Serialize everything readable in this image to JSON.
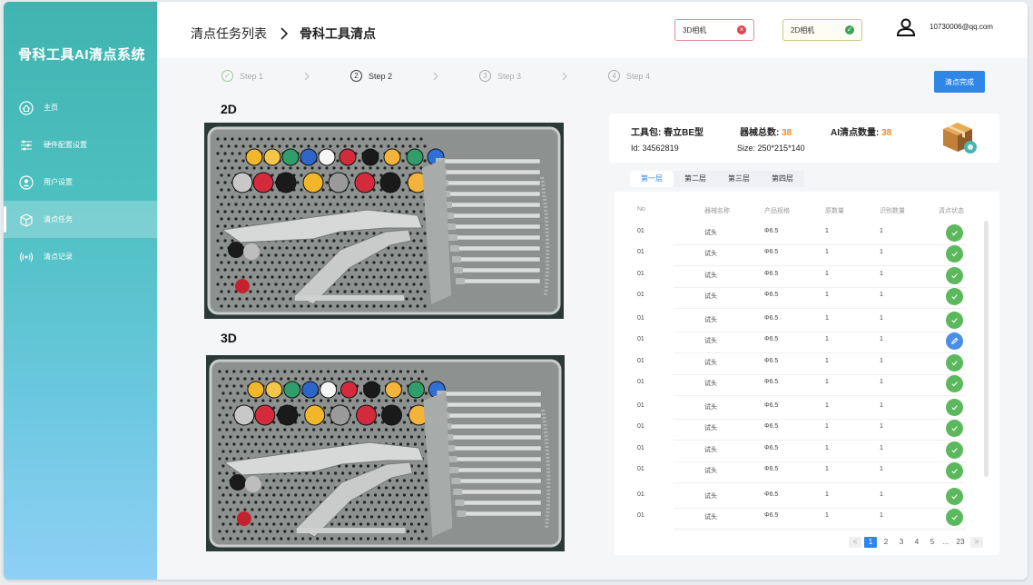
{
  "app": {
    "title": "骨科工具AI清点系统"
  },
  "sidebar": {
    "items": [
      {
        "label": "主页",
        "icon": "home-icon",
        "active": false
      },
      {
        "label": "硬件配置设置",
        "icon": "sliders-icon",
        "active": false
      },
      {
        "label": "用户设置",
        "icon": "user-icon",
        "active": false
      },
      {
        "label": "清点任务",
        "icon": "box-icon",
        "active": true
      },
      {
        "label": "清点记录",
        "icon": "signal-icon",
        "active": false
      }
    ]
  },
  "header": {
    "breadcrumb_parent": "清点任务列表",
    "breadcrumb_current": "骨科工具清点",
    "camera_3d": {
      "label": "3D相机",
      "status": "error"
    },
    "camera_2d": {
      "label": "2D相机",
      "status": "ok"
    },
    "user_email": "10730006@qq.com"
  },
  "steps": [
    {
      "label": "Step 1",
      "marker": "✓",
      "state": "done"
    },
    {
      "label": "Step 2",
      "marker": "2",
      "state": "current"
    },
    {
      "label": "Step 3",
      "marker": "3",
      "state": "todo"
    },
    {
      "label": "Step 4",
      "marker": "4",
      "state": "todo"
    }
  ],
  "finish_button": "清点完成",
  "images": {
    "label_2d": "2D",
    "label_3d": "3D"
  },
  "toolkit": {
    "kit_label": "工具包:",
    "kit_name": "春立BE型",
    "total_label": "器械总数:",
    "total_value": "38",
    "ai_label": "AI清点数量:",
    "ai_value": "38",
    "id_label": "Id:",
    "id_value": "34562819",
    "size_label": "Size:",
    "size_value": "250*215*140"
  },
  "layer_tabs": [
    "第一层",
    "第二层",
    "第三层",
    "第四层"
  ],
  "table": {
    "headers": [
      "No",
      "器械名称",
      "产品规格",
      "原数量",
      "识别数量",
      "清点状态"
    ],
    "rows": [
      {
        "no": "01",
        "name": "试头",
        "spec": "Φ6.5",
        "orig": "1",
        "detected": "1",
        "status": "ok"
      },
      {
        "no": "01",
        "name": "试头",
        "spec": "Φ6.5",
        "orig": "1",
        "detected": "1",
        "status": "ok"
      },
      {
        "no": "01",
        "name": "试头",
        "spec": "Φ6.5",
        "orig": "1",
        "detected": "1",
        "status": "ok"
      },
      {
        "no": "01",
        "name": "试头",
        "spec": "Φ6.5",
        "orig": "1",
        "detected": "1",
        "status": "ok"
      },
      {
        "no": "01",
        "name": "试头",
        "spec": "Φ6.5",
        "orig": "1",
        "detected": "1",
        "status": "ok"
      },
      {
        "no": "01",
        "name": "试头",
        "spec": "Φ6.5",
        "orig": "1",
        "detected": "1",
        "status": "edit"
      },
      {
        "no": "01",
        "name": "试头",
        "spec": "Φ6.5",
        "orig": "1",
        "detected": "1",
        "status": "ok"
      },
      {
        "no": "01",
        "name": "试头",
        "spec": "Φ6.5",
        "orig": "1",
        "detected": "1",
        "status": "ok"
      },
      {
        "no": "01",
        "name": "试头",
        "spec": "Φ6.5",
        "orig": "1",
        "detected": "1",
        "status": "ok"
      },
      {
        "no": "01",
        "name": "试头",
        "spec": "Φ6.5",
        "orig": "1",
        "detected": "1",
        "status": "ok"
      },
      {
        "no": "01",
        "name": "试头",
        "spec": "Φ6.5",
        "orig": "1",
        "detected": "1",
        "status": "ok"
      },
      {
        "no": "01",
        "name": "试头",
        "spec": "Φ6.5",
        "orig": "1",
        "detected": "1",
        "status": "ok"
      },
      {
        "no": "01",
        "name": "试头",
        "spec": "Φ6.5",
        "orig": "1",
        "detected": "1",
        "status": "ok"
      },
      {
        "no": "01",
        "name": "试头",
        "spec": "Φ6.5",
        "orig": "1",
        "detected": "1",
        "status": "ok"
      }
    ]
  },
  "pagination": {
    "prev": "<",
    "pages": [
      "1",
      "2",
      "3",
      "4",
      "5"
    ],
    "current": "1",
    "ellipsis": "...",
    "last": "23",
    "next": ">"
  },
  "colors": {
    "accent": "#2f86e6",
    "ok": "#5cb85c",
    "error": "#e0454f",
    "highlight": "#f0892f",
    "sidebar_top": "#3fb4b0",
    "sidebar_bottom": "#8fd0f6"
  }
}
